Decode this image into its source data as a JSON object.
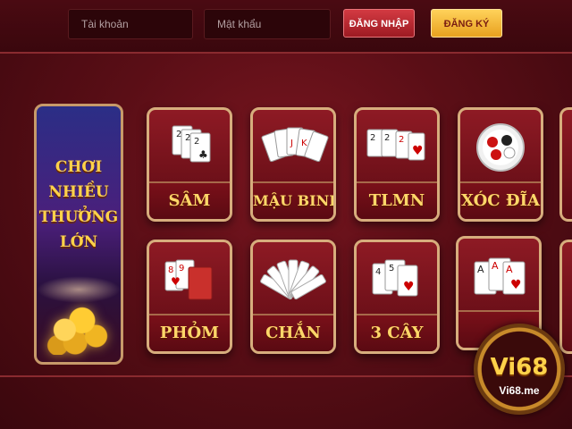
{
  "header": {
    "username_placeholder": "Tài khoản",
    "password_placeholder": "Mật khẩu",
    "login_label": "ĐĂNG NHẬP",
    "register_label": "ĐĂNG KÝ"
  },
  "banner": {
    "line1": "CHƠI NHIỀU",
    "line2": "THƯỞNG LỚN"
  },
  "games": [
    {
      "label": "SÂM",
      "icon": "sam-cards-icon"
    },
    {
      "label": "MẬU BINH",
      "icon": "mau-binh-cards-icon"
    },
    {
      "label": "TLMN",
      "icon": "tlmn-cards-icon"
    },
    {
      "label": "XÓC ĐĨA",
      "icon": "xoc-dia-plate-icon"
    },
    {
      "label": "PHỎM",
      "icon": "phom-cards-icon"
    },
    {
      "label": "CHẮN",
      "icon": "chan-cards-fan-icon"
    },
    {
      "label": "3 CÂY",
      "icon": "three-cards-icon"
    },
    {
      "label": "",
      "icon": "aces-cards-icon"
    }
  ],
  "logo": {
    "name": "Vi68",
    "url": "Vi68.me"
  },
  "colors": {
    "background": "#5a0e16",
    "gold": "#ffd769",
    "login_red": "#d33a42",
    "register_gold": "#ffd25a"
  }
}
